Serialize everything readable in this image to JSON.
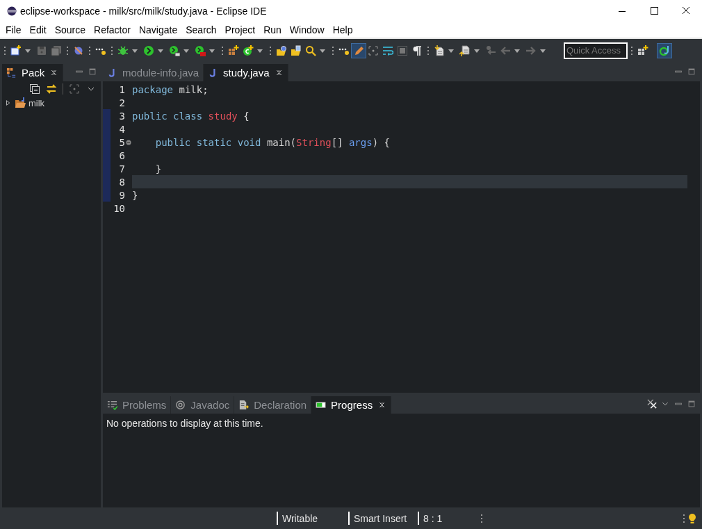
{
  "window": {
    "title": "eclipse-workspace - milk/src/milk/study.java - Eclipse IDE"
  },
  "menu": [
    "File",
    "Edit",
    "Source",
    "Refactor",
    "Navigate",
    "Search",
    "Project",
    "Run",
    "Window",
    "Help"
  ],
  "toolbar": {
    "highlight_toggle": {
      "selected": true
    },
    "quick_access": {
      "placeholder": "Quick Access"
    }
  },
  "explorer": {
    "tab": {
      "label": "Pack",
      "selected": true
    },
    "tree": [
      {
        "label": "milk",
        "expanded": false
      }
    ]
  },
  "editor": {
    "tabs": [
      {
        "label": "module-info.java",
        "selected": false
      },
      {
        "label": "study.java",
        "selected": true
      }
    ],
    "lines": [
      {
        "number": "1",
        "tokens": [
          {
            "kind": "keyword",
            "text": "package"
          },
          {
            "kind": "plain",
            "text": "milk;"
          }
        ]
      },
      {
        "number": "2"
      },
      {
        "number": "3",
        "tokens": [
          {
            "kind": "keyword",
            "text": "public"
          },
          {
            "kind": "keyword",
            "text": "class"
          },
          {
            "kind": "type",
            "text": "study"
          },
          {
            "kind": "plain",
            "text": "{"
          }
        ]
      },
      {
        "number": "4"
      },
      {
        "number": "5",
        "fold": true,
        "indented": true,
        "tokens": [
          {
            "kind": "keyword",
            "text": "public"
          },
          {
            "kind": "keyword",
            "text": "static"
          },
          {
            "kind": "keyword",
            "text": "void"
          },
          {
            "kind": "method",
            "text": "main"
          },
          {
            "kind": "plain",
            "text": "(",
            "attached": true
          },
          {
            "kind": "type",
            "text": "String",
            "attached": true
          },
          {
            "kind": "plain",
            "text": "[]",
            "attached": true
          },
          {
            "kind": "param",
            "text": "args"
          },
          {
            "kind": "plain",
            "text": ")",
            "attached": true
          },
          {
            "kind": "plain",
            "text": "{"
          }
        ]
      },
      {
        "number": "6"
      },
      {
        "number": "7",
        "indented": true,
        "tokens": [
          {
            "kind": "plain",
            "text": "}"
          }
        ]
      },
      {
        "number": "8",
        "current": true
      },
      {
        "number": "9",
        "tokens": [
          {
            "kind": "plain",
            "text": "}"
          }
        ]
      },
      {
        "number": "10"
      }
    ]
  },
  "bottom_panel": {
    "tabs": [
      {
        "label": "Problems",
        "selected": false
      },
      {
        "label": "Javadoc",
        "selected": false
      },
      {
        "label": "Declaration",
        "selected": false
      },
      {
        "label": "Progress",
        "selected": true
      }
    ],
    "message": "No operations to display at this time."
  },
  "status_bar": [
    "Writable",
    "Smart Insert",
    "8 : 1"
  ]
}
